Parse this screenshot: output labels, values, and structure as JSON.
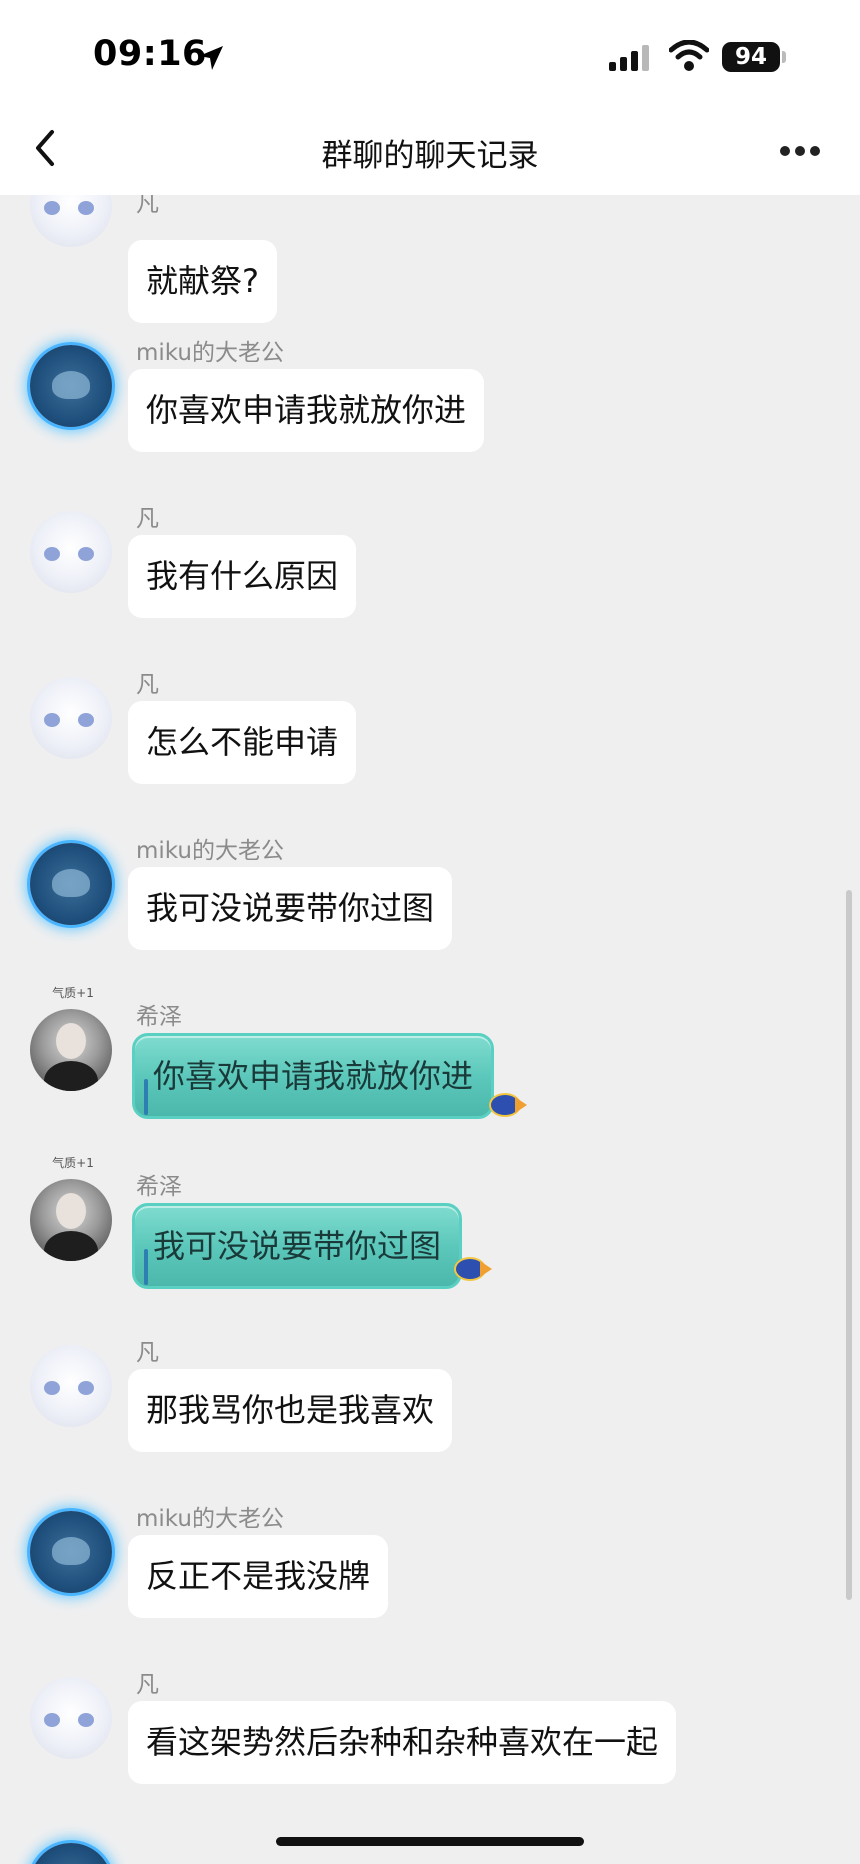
{
  "status": {
    "time": "09:16",
    "battery": "94"
  },
  "nav": {
    "title": "群聊的聊天记录"
  },
  "messages": [
    {
      "sender": "凡",
      "text": "就献祭?"
    },
    {
      "sender": "miku的大老公",
      "text": "你喜欢申请我就放你进"
    },
    {
      "sender": "凡",
      "text": "我有什么原因"
    },
    {
      "sender": "凡",
      "text": "怎么不能申请"
    },
    {
      "sender": "miku的大老公",
      "text": "我可没说要带你过图"
    },
    {
      "sender": "希泽",
      "text": "你喜欢申请我就放你进"
    },
    {
      "sender": "希泽",
      "text": "我可没说要带你过图"
    },
    {
      "sender": "凡",
      "text": "那我骂你也是我喜欢"
    },
    {
      "sender": "miku的大老公",
      "text": "反正不是我没牌"
    },
    {
      "sender": "凡",
      "text": "看这架势然后杂种和杂种喜欢在一起"
    }
  ],
  "avatar_badge": "气质+1",
  "colors": {
    "teal_bubble": "#5cc8bb",
    "background": "#efeff0",
    "glow": "#49b4ff"
  }
}
